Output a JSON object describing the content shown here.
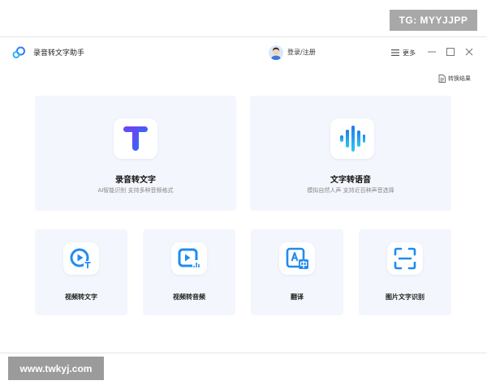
{
  "watermarks": {
    "top": "TG: MYYJJPP",
    "bottom": "www.twkyj.com"
  },
  "app": {
    "title": "录音转文字助手"
  },
  "header": {
    "login_label": "登录/注册",
    "more_label": "更多"
  },
  "toolbar": {
    "results_label": "转换结果"
  },
  "features": {
    "large": [
      {
        "title": "录音转文字",
        "subtitle": "AI智能识别 支持多种音频格式",
        "icon": "text-t-icon"
      },
      {
        "title": "文字转语音",
        "subtitle": "模拟自然人声 支持近百种声音选择",
        "icon": "soundwave-icon"
      }
    ],
    "small": [
      {
        "title": "视频转文字",
        "icon": "video-to-text-icon"
      },
      {
        "title": "视频转音频",
        "icon": "video-to-audio-icon"
      },
      {
        "title": "翻译",
        "icon": "translate-icon"
      },
      {
        "title": "图片文字识别",
        "icon": "image-ocr-icon"
      }
    ]
  },
  "colors": {
    "accent": "#2f7cf6",
    "purple": "#6a45e8",
    "card_bg": "#f3f6fc"
  }
}
